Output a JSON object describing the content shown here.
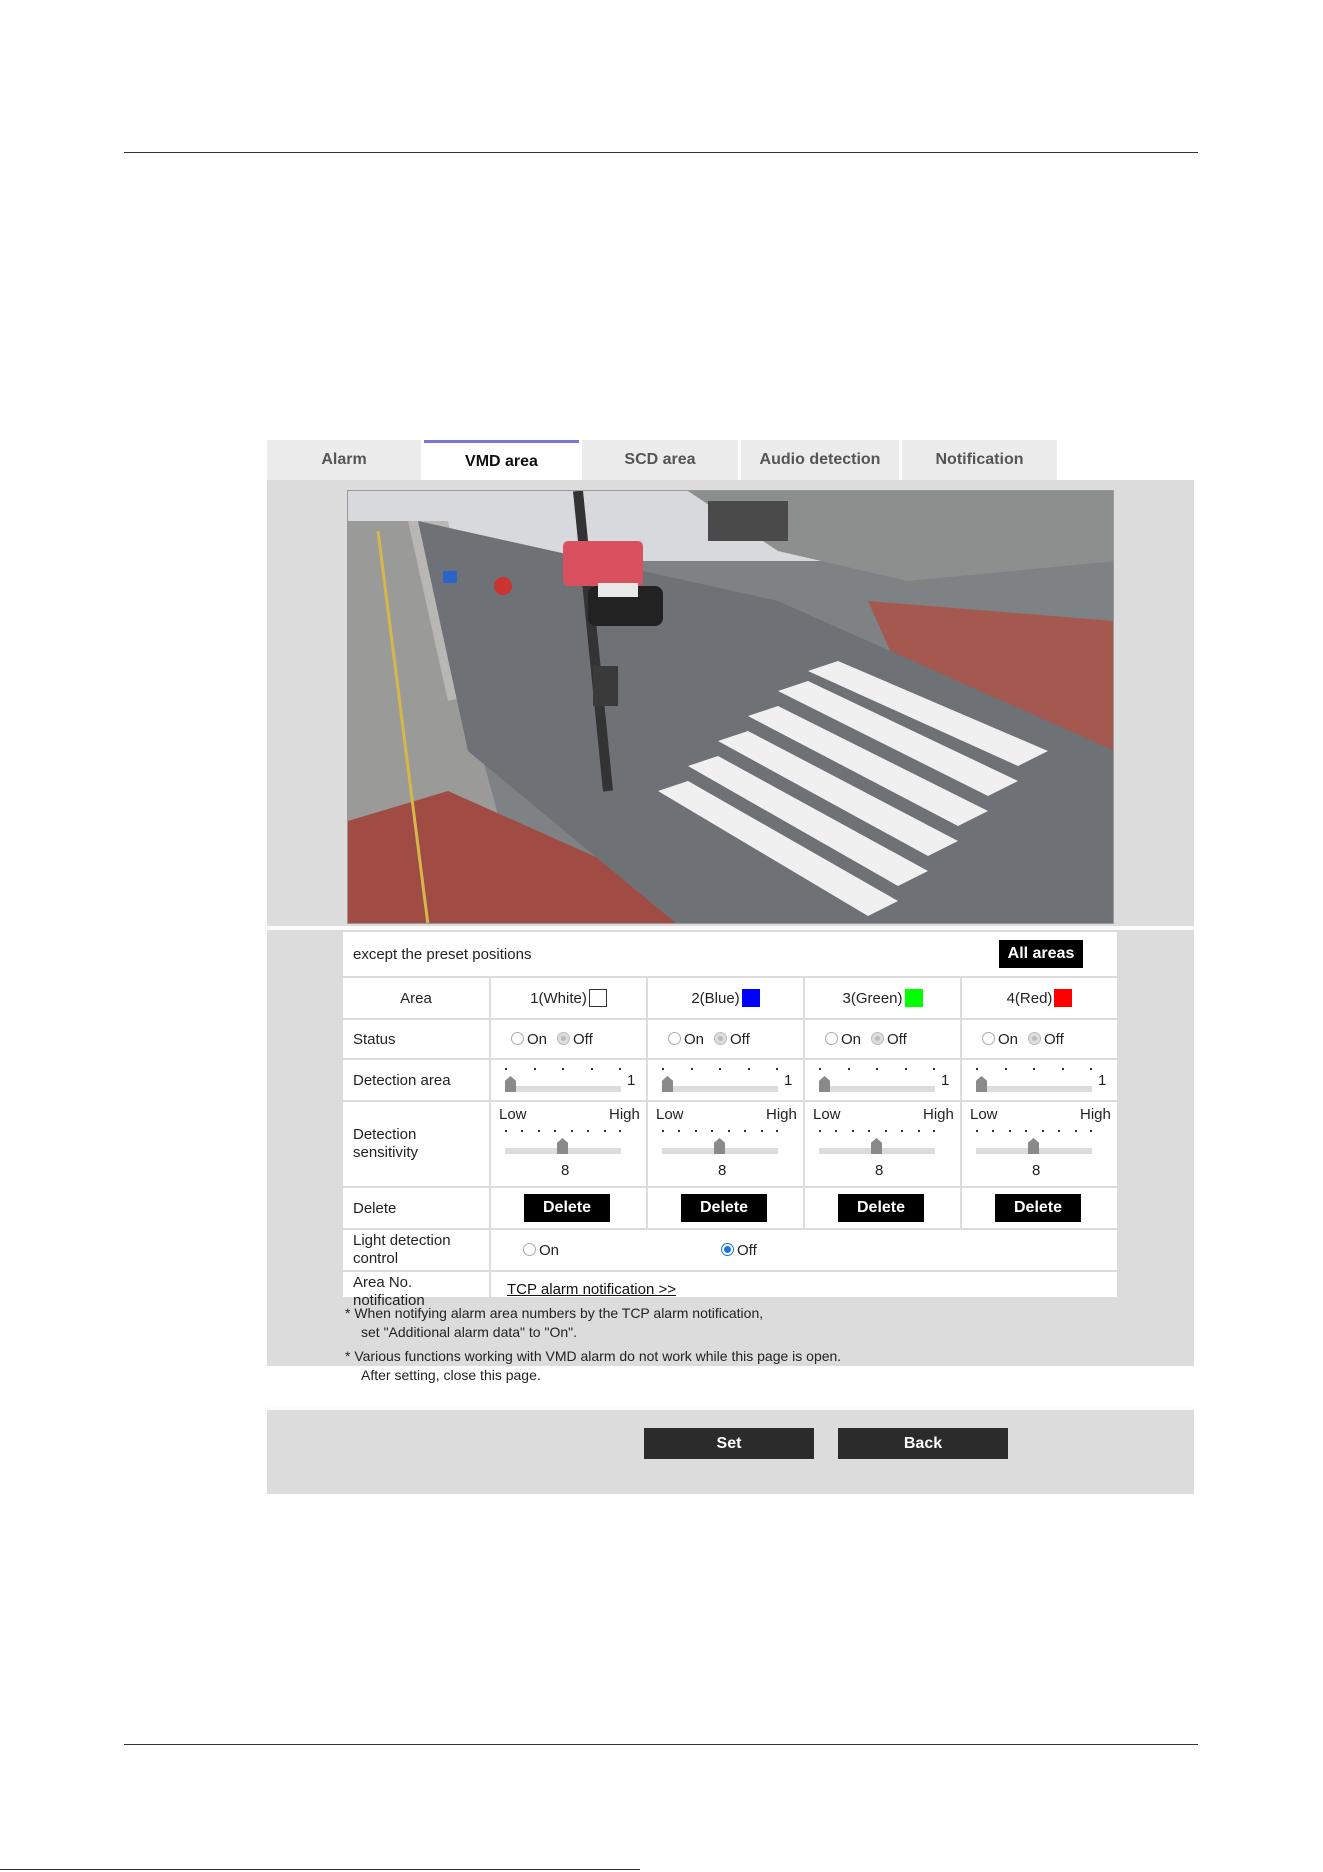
{
  "tabs": [
    {
      "label": "Alarm",
      "active": false
    },
    {
      "label": "VMD area",
      "active": true
    },
    {
      "label": "SCD area",
      "active": false
    },
    {
      "label": "Audio detection",
      "active": false
    },
    {
      "label": "Notification",
      "active": false
    }
  ],
  "preset_text": "except the preset positions",
  "all_areas_label": "All areas",
  "table": {
    "area_label": "Area",
    "areas": [
      {
        "label": "1(White)",
        "color": "#ffffff"
      },
      {
        "label": "2(Blue)",
        "color": "#0000ff"
      },
      {
        "label": "3(Green)",
        "color": "#00ff00"
      },
      {
        "label": "4(Red)",
        "color": "#ff0000"
      }
    ],
    "status_label": "Status",
    "on_label": "On",
    "off_label": "Off",
    "detection_area_label": "Detection area",
    "detection_area_value": "1",
    "detection_sensitivity_label_1": "Detection",
    "detection_sensitivity_label_2": "sensitivity",
    "low_label": "Low",
    "high_label": "High",
    "sensitivity_value": "8",
    "delete_label": "Delete",
    "delete_button": "Delete",
    "light_label_1": "Light detection",
    "light_label_2": "control",
    "light_on": "On",
    "light_off": "Off",
    "light_selected": "Off",
    "area_no_label_1": "Area No.",
    "area_no_label_2": "notification",
    "tcp_link": "TCP alarm notification >>"
  },
  "notes": {
    "note1_line1": "* When notifying alarm area numbers by the TCP alarm notification,",
    "note1_line2": "set \"Additional alarm data\" to \"On\".",
    "note2_line1": "* Various functions working with VMD alarm do not work while this page is open.",
    "note2_line2": "After setting, close this page."
  },
  "buttons": {
    "set": "Set",
    "back": "Back"
  }
}
